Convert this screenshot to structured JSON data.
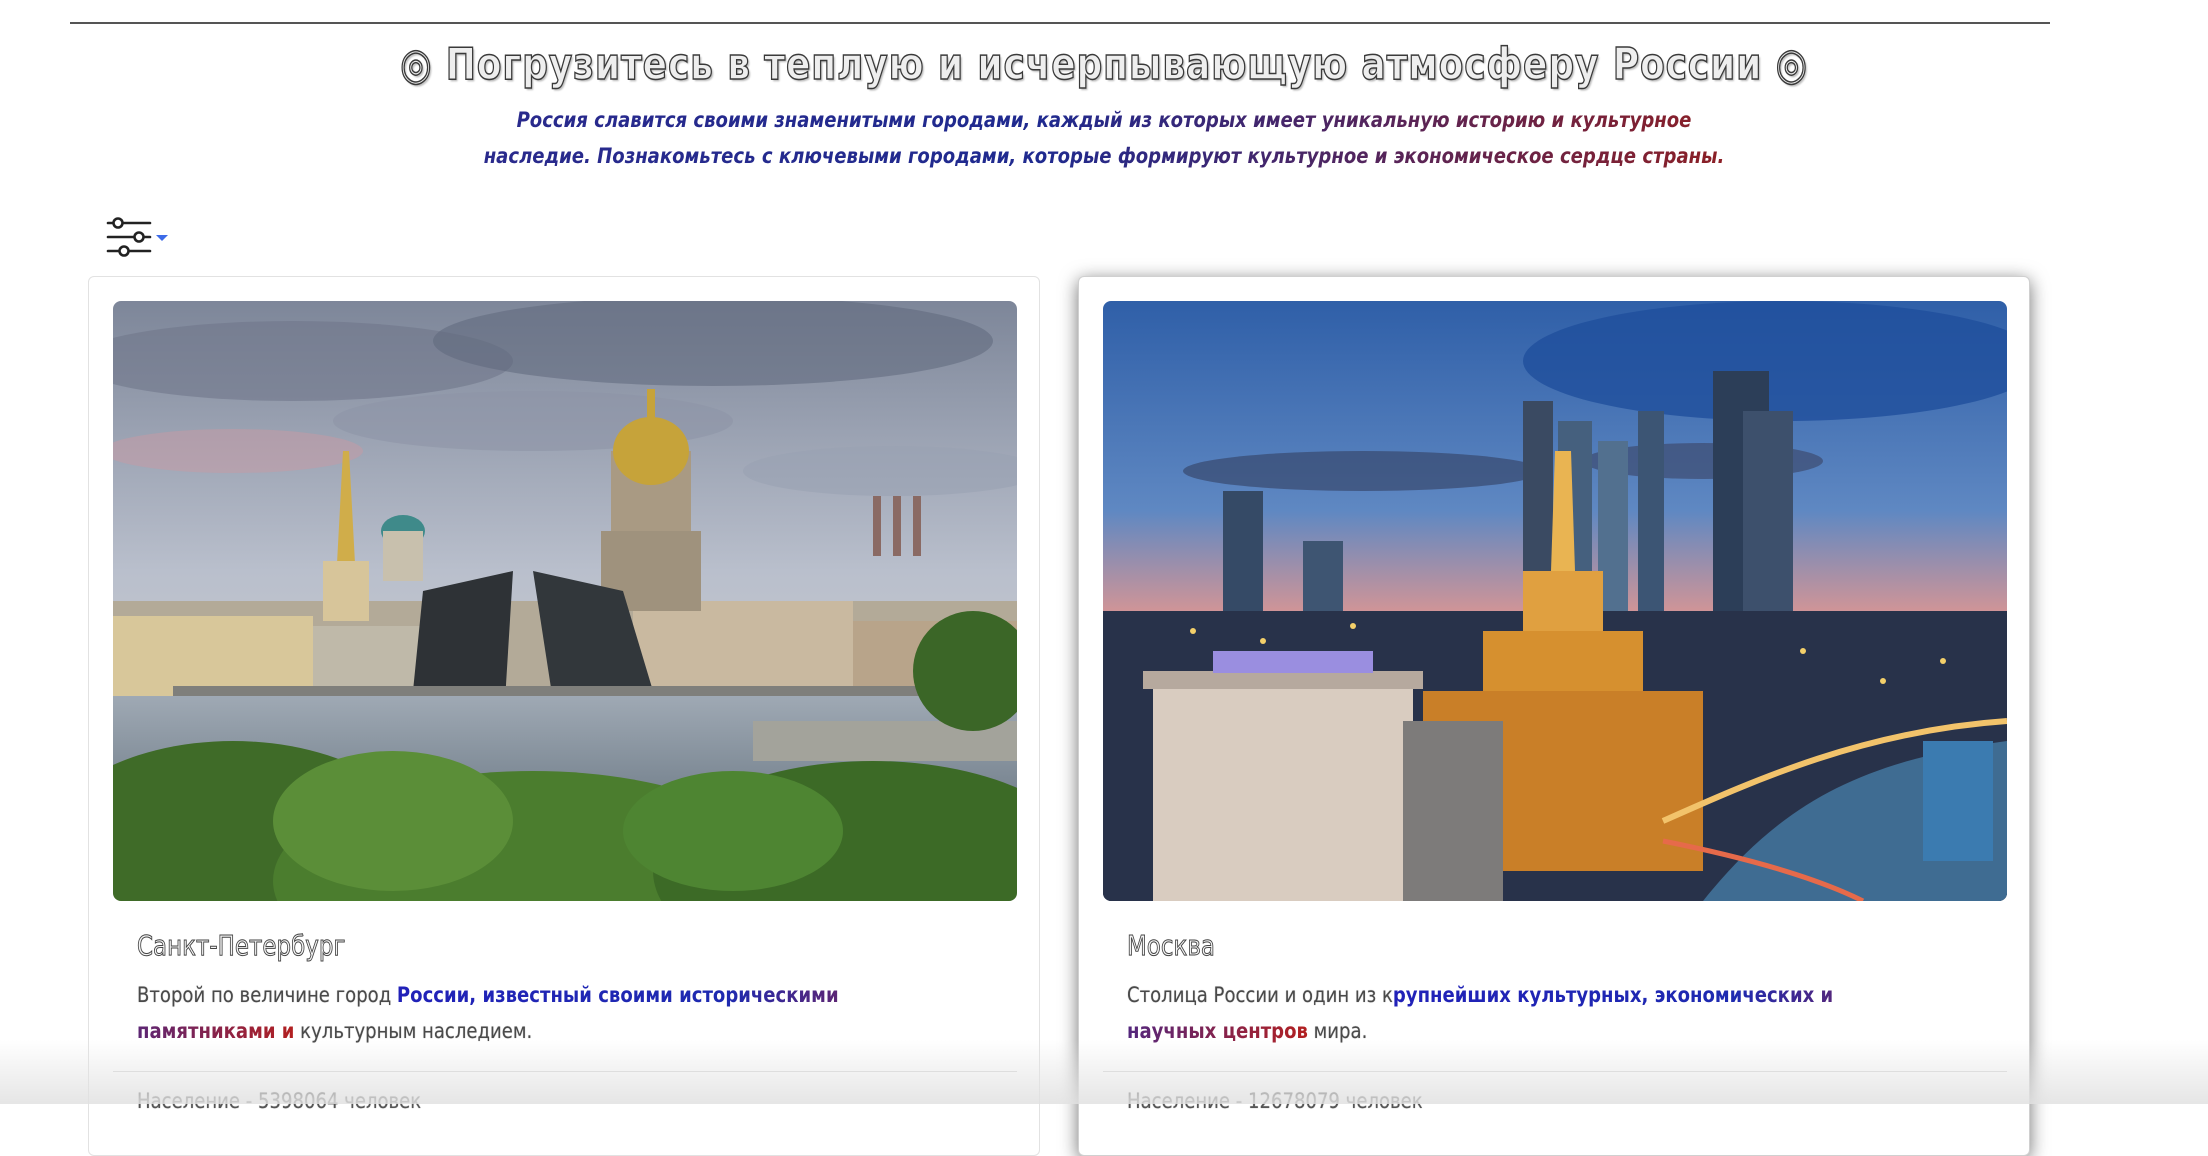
{
  "hero": {
    "title": "◎ Погрузитесь в теплую и исчерпывающую атмосферу России ◎",
    "subtitle": "Россия славится своими знаменитыми городами, каждый из которых имеет уникальную историю и культурное наследие. Познакомьтесь с ключевыми городами, которые формируют культурное и экономическое сердце страны."
  },
  "toolbar": {
    "filter_icon": "sliders-icon",
    "dropdown_icon": "caret-down-icon",
    "accent_color": "#3d6be8"
  },
  "cities": [
    {
      "name": "Санкт-Петербург",
      "description_plain": "Второй по величине город ",
      "description_accent": "России, известный своими историческими памятниками и",
      "description_tail": " культурным наследием.",
      "population": "Население - 5398064 человек",
      "image": "saint-petersburg-photo"
    },
    {
      "name": "Москва",
      "description_plain": "Столица России и один из к",
      "description_accent": "рупнейших культурных, экономических и научных центров",
      "description_tail": " мира.",
      "population": "Население - 12678079 человек",
      "image": "moscow-photo"
    }
  ]
}
